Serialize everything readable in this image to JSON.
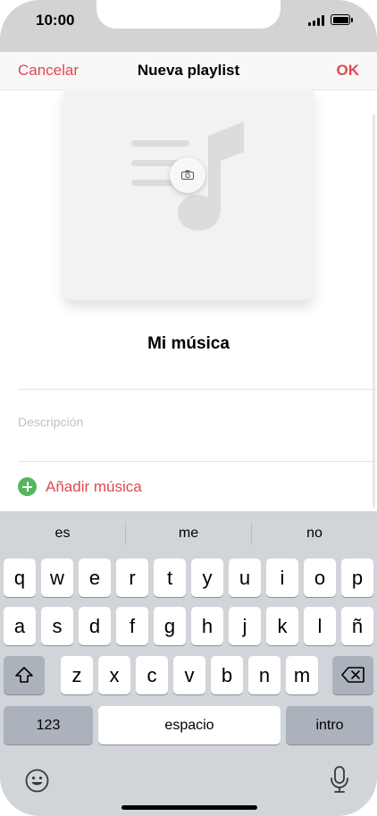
{
  "status_bar": {
    "time": "10:00"
  },
  "nav": {
    "cancel": "Cancelar",
    "title": "Nueva playlist",
    "ok": "OK"
  },
  "playlist": {
    "name": "Mi música",
    "description_placeholder": "Descripción",
    "add_music": "Añadir música"
  },
  "keyboard": {
    "suggestions": [
      "es",
      "me",
      "no"
    ],
    "row1": [
      "q",
      "w",
      "e",
      "r",
      "t",
      "y",
      "u",
      "i",
      "o",
      "p"
    ],
    "row2": [
      "a",
      "s",
      "d",
      "f",
      "g",
      "h",
      "j",
      "k",
      "l",
      "ñ"
    ],
    "row3": [
      "z",
      "x",
      "c",
      "v",
      "b",
      "n",
      "m"
    ],
    "numbers": "123",
    "space": "espacio",
    "return": "intro"
  },
  "colors": {
    "accent": "#e0484f",
    "add_green": "#56b65e",
    "keyboard_bg": "#d1d4d9"
  },
  "icons": [
    "camera-icon",
    "music-note-icon",
    "shift-icon",
    "backspace-icon",
    "emoji-icon",
    "microphone-icon"
  ]
}
